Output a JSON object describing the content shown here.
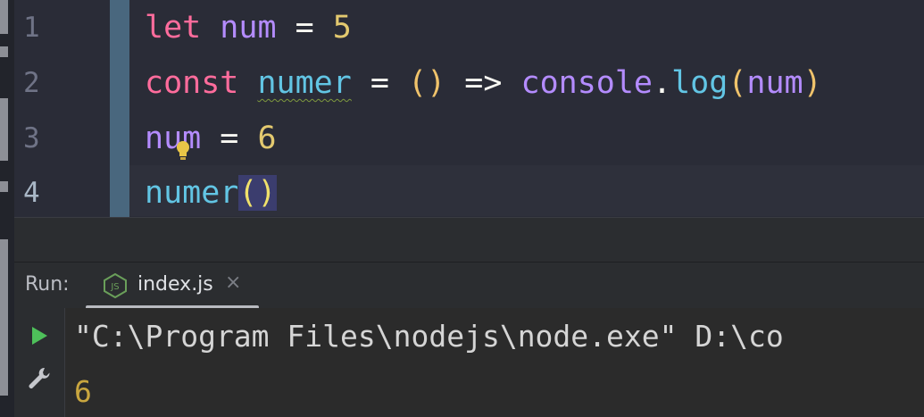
{
  "editor": {
    "line_numbers": [
      "1",
      "2",
      "3",
      "4"
    ],
    "lines": [
      {
        "kw": "let",
        "var": "num",
        "op": "=",
        "num": "5"
      },
      {
        "kw": "const",
        "fn": "numer",
        "eq": "=",
        "parens": "()",
        "arrow": "=>",
        "obj": "console",
        "dot": ".",
        "method": "log",
        "open": "(",
        "arg": "num",
        "close": ")"
      },
      {
        "var": "num",
        "op": "=",
        "num": "6"
      },
      {
        "fn": "numer",
        "parens": "()"
      }
    ]
  },
  "run": {
    "label": "Run:",
    "tab_label": "index.js",
    "tab_close": "×",
    "console_lines": [
      "\"C:\\Program Files\\nodejs\\node.exe\" D:\\co",
      "6"
    ]
  },
  "icons": {
    "bulb": "lightbulb-icon",
    "play": "play-icon",
    "wrench": "wrench-icon",
    "nodejs": "nodejs-file-icon"
  },
  "colors": {
    "keyword": "#ff6c9c",
    "variable": "#b48cff",
    "function": "#62c5e4",
    "number": "#e3c96f",
    "run_green": "#4ec05a"
  }
}
